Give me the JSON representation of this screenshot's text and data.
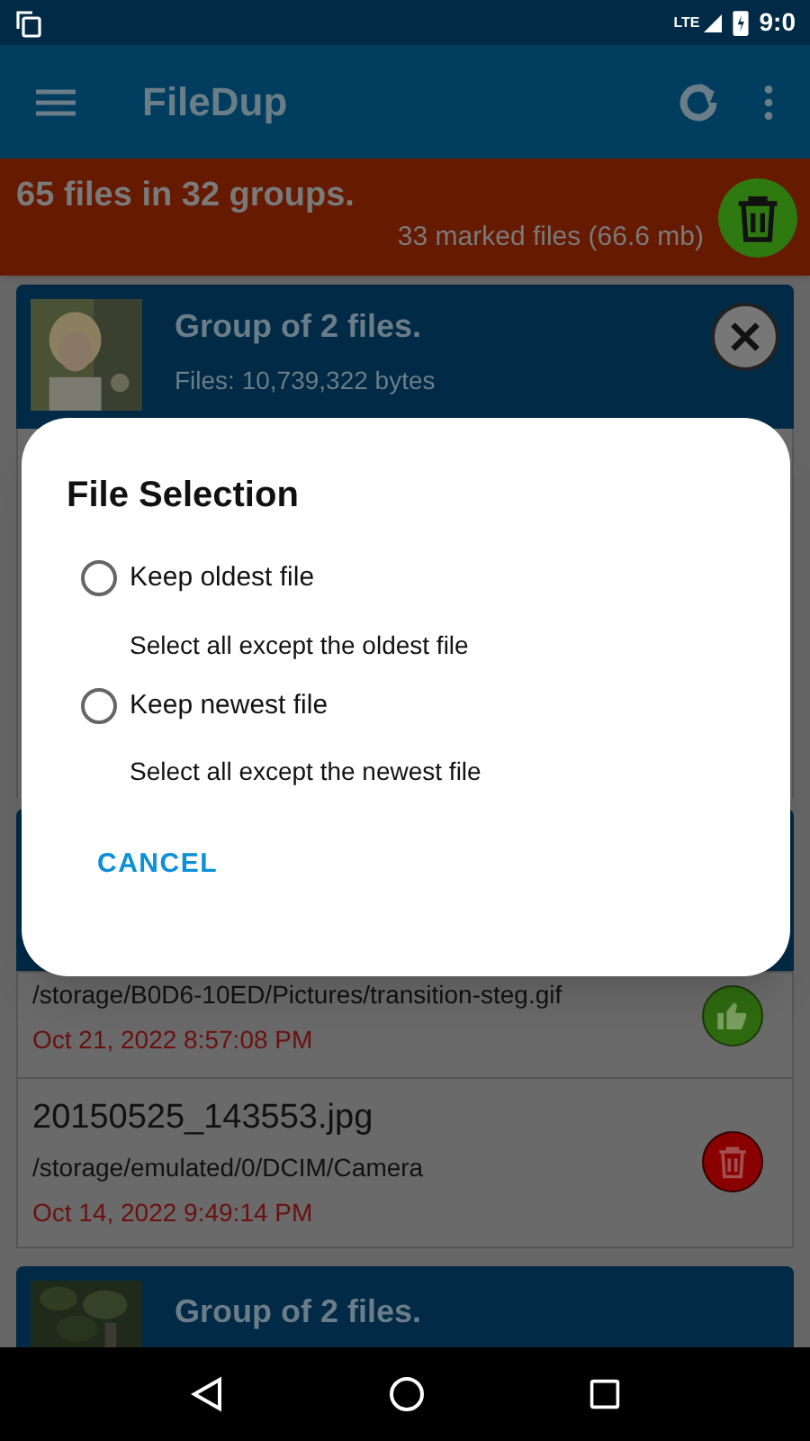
{
  "status_bar": {
    "network": "LTE",
    "time": "9:0"
  },
  "app_bar": {
    "title": "FileDup"
  },
  "summary": {
    "title": "65 files in 32 groups.",
    "detail": "33 marked files (66.6 mb)"
  },
  "groups": [
    {
      "title": "Group of 2 files.",
      "size": "Files:  10,739,322 bytes"
    },
    {
      "files": [
        {
          "path": "/storage/B0D6-10ED/Pictures/transition-steg.gif",
          "date": "Oct 21, 2022 8:57:08 PM",
          "kind": "keep"
        },
        {
          "name": "20150525_143553.jpg",
          "path": "/storage/emulated/0/DCIM/Camera",
          "date": "Oct 14, 2022 9:49:14 PM",
          "kind": "delete"
        }
      ]
    },
    {
      "title": "Group of 2 files."
    }
  ],
  "dialog": {
    "title": "File Selection",
    "options": [
      {
        "label": "Keep oldest file",
        "description": "Select all except the oldest file",
        "selected": false
      },
      {
        "label": "Keep newest file",
        "description": "Select all except the newest file",
        "selected": false
      }
    ],
    "button": "CANCEL"
  }
}
